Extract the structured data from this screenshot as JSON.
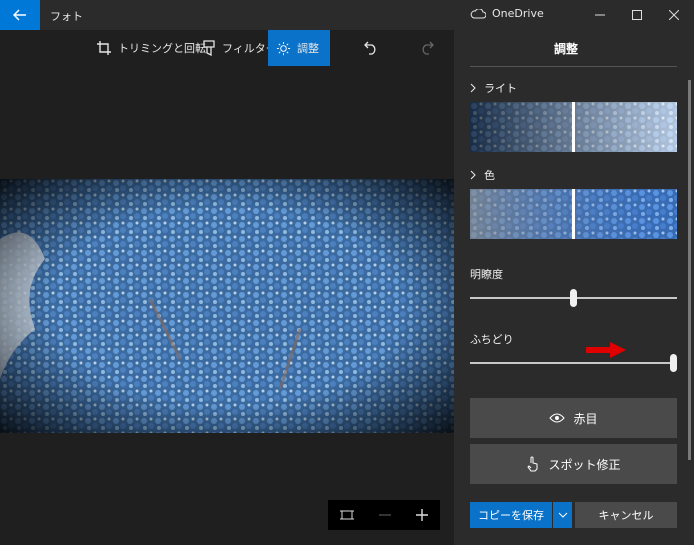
{
  "app": {
    "title": "フォト",
    "onedrive_label": "OneDrive"
  },
  "toolbar": {
    "crop_label": "トリミングと回転",
    "filter_label": "フィルター",
    "adjust_label": "調整"
  },
  "panel": {
    "title": "調整",
    "light_label": "ライト",
    "color_label": "色",
    "clarity_label": "明瞭度",
    "clarity_value": 0.5,
    "vignette_label": "ふちどり",
    "vignette_value": 1.0,
    "redeye_label": "赤目",
    "spotfix_label": "スポット修正",
    "copy_save_label": "コピーを保存",
    "cancel_label": "キャンセル"
  },
  "colors": {
    "accent": "#0a73c9",
    "annotation_arrow": "#e00000"
  }
}
